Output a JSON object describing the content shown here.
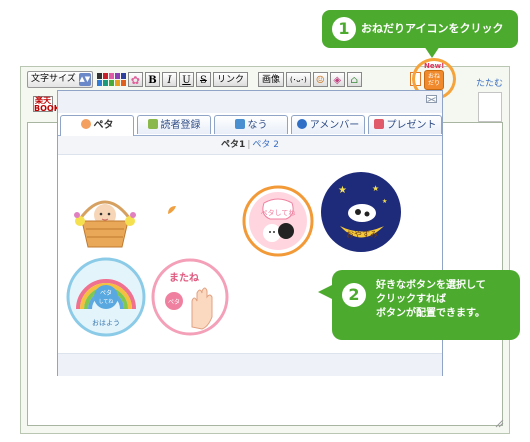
{
  "toolbar": {
    "font_size_label": "文字サイズ",
    "bold": "B",
    "italic": "I",
    "underline": "U",
    "strike": "S",
    "link": "リンク",
    "image": "画像",
    "emoji": "(･ᴗ･)",
    "swatch_colors": [
      "#333333",
      "#c8202a",
      "#e05aa8",
      "#8a3fb4",
      "#2f3f9e",
      "#2f7bd8",
      "#1c9a7d",
      "#48a83a",
      "#e8a020",
      "#e06020"
    ]
  },
  "omedetou_button": {
    "label": "おね\nだり",
    "badge": "New!"
  },
  "collapse_link": "たたむ",
  "rakuten_label": "楽天\nBOOKS",
  "callout1": {
    "number": "1",
    "text": "おねだりアイコンをクリック"
  },
  "callout2": {
    "number": "2",
    "text_lines": [
      "好きなボタンを選択して",
      "クリックすれば",
      "ボタンが配置できます。"
    ]
  },
  "popup": {
    "tabs": [
      {
        "label": "ペタ",
        "active": true
      },
      {
        "label": "読者登録",
        "active": false
      },
      {
        "label": "なう",
        "active": false
      },
      {
        "label": "アメンバー",
        "active": false
      },
      {
        "label": "プレゼント",
        "active": false
      }
    ],
    "subtabs": {
      "current": "ペタ1",
      "separator": "|",
      "other": "ペタ 2"
    },
    "icons": [
      {
        "name": "baby-basket",
        "text": ""
      },
      {
        "name": "peta-shiteme",
        "text": "ペタしてね"
      },
      {
        "name": "oyasumi",
        "text": "おやすみ"
      },
      {
        "name": "rainbow-peta",
        "text": "ペタしてね おはよう"
      },
      {
        "name": "matane",
        "text": "またね"
      }
    ]
  }
}
